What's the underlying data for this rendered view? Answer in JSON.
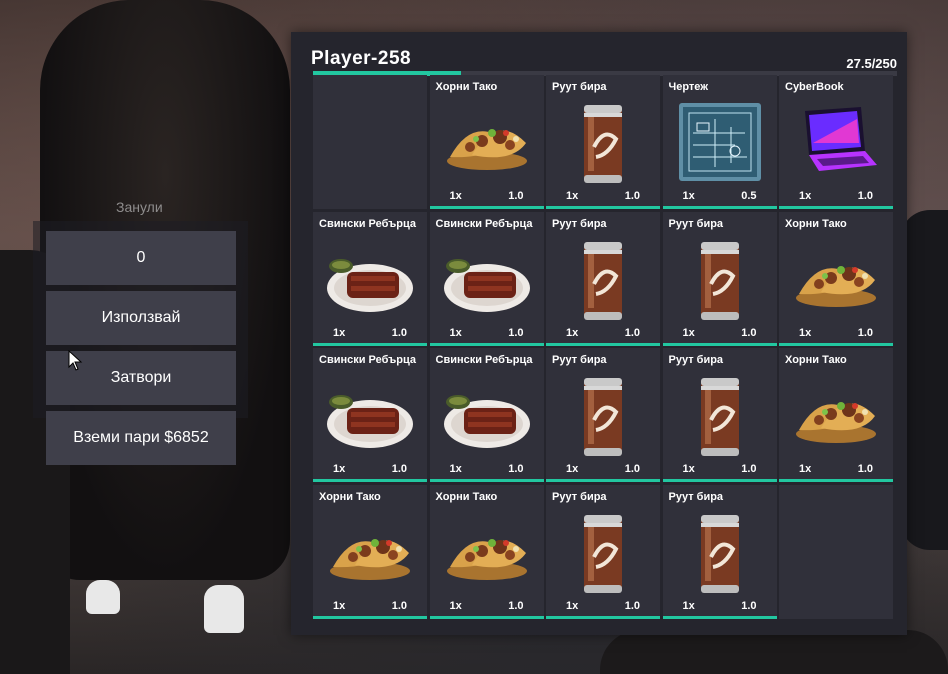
{
  "scene": {
    "hint_text": "Занули"
  },
  "actions": [
    {
      "label": "0",
      "name": "amount-input",
      "icon": "none"
    },
    {
      "label": "Използвай",
      "name": "use-button",
      "icon": "none"
    },
    {
      "label": "Затвори",
      "name": "close-button",
      "icon": "none"
    },
    {
      "label": "Вземи пари $6852",
      "name": "take-money-button",
      "icon": "none"
    }
  ],
  "inventory": {
    "player_name": "Player-258",
    "weight_text": "27.5/250",
    "weight_current": 27.5,
    "weight_max": 250,
    "accent_color": "#22c7a0"
  },
  "slots": [
    {
      "name": "",
      "qty": "",
      "weight": "",
      "icon": "empty"
    },
    {
      "name": "Хорни Тако",
      "qty": "1x",
      "weight": "1.0",
      "icon": "taco-icon"
    },
    {
      "name": "Руут бира",
      "qty": "1x",
      "weight": "1.0",
      "icon": "root-beer-can-icon"
    },
    {
      "name": "Чертеж",
      "qty": "1x",
      "weight": "0.5",
      "icon": "blueprint-icon"
    },
    {
      "name": "CyberBook",
      "qty": "1x",
      "weight": "1.0",
      "icon": "laptop-icon"
    },
    {
      "name": "Свински Ребърца",
      "qty": "1x",
      "weight": "1.0",
      "icon": "ribs-icon"
    },
    {
      "name": "Свински Ребърца",
      "qty": "1x",
      "weight": "1.0",
      "icon": "ribs-icon"
    },
    {
      "name": "Руут бира",
      "qty": "1x",
      "weight": "1.0",
      "icon": "root-beer-can-icon"
    },
    {
      "name": "Руут бира",
      "qty": "1x",
      "weight": "1.0",
      "icon": "root-beer-can-icon"
    },
    {
      "name": "Хорни Тако",
      "qty": "1x",
      "weight": "1.0",
      "icon": "taco-icon"
    },
    {
      "name": "Свински Ребърца",
      "qty": "1x",
      "weight": "1.0",
      "icon": "ribs-icon"
    },
    {
      "name": "Свински Ребърца",
      "qty": "1x",
      "weight": "1.0",
      "icon": "ribs-icon"
    },
    {
      "name": "Руут бира",
      "qty": "1x",
      "weight": "1.0",
      "icon": "root-beer-can-icon"
    },
    {
      "name": "Руут бира",
      "qty": "1x",
      "weight": "1.0",
      "icon": "root-beer-can-icon"
    },
    {
      "name": "Хорни Тако",
      "qty": "1x",
      "weight": "1.0",
      "icon": "taco-icon"
    },
    {
      "name": "Хорни Тако",
      "qty": "1x",
      "weight": "1.0",
      "icon": "taco-icon"
    },
    {
      "name": "Хорни Тако",
      "qty": "1x",
      "weight": "1.0",
      "icon": "taco-icon"
    },
    {
      "name": "Руут бира",
      "qty": "1x",
      "weight": "1.0",
      "icon": "root-beer-can-icon"
    },
    {
      "name": "Руут бира",
      "qty": "1x",
      "weight": "1.0",
      "icon": "root-beer-can-icon"
    },
    {
      "name": "",
      "qty": "",
      "weight": "",
      "icon": "empty"
    }
  ]
}
